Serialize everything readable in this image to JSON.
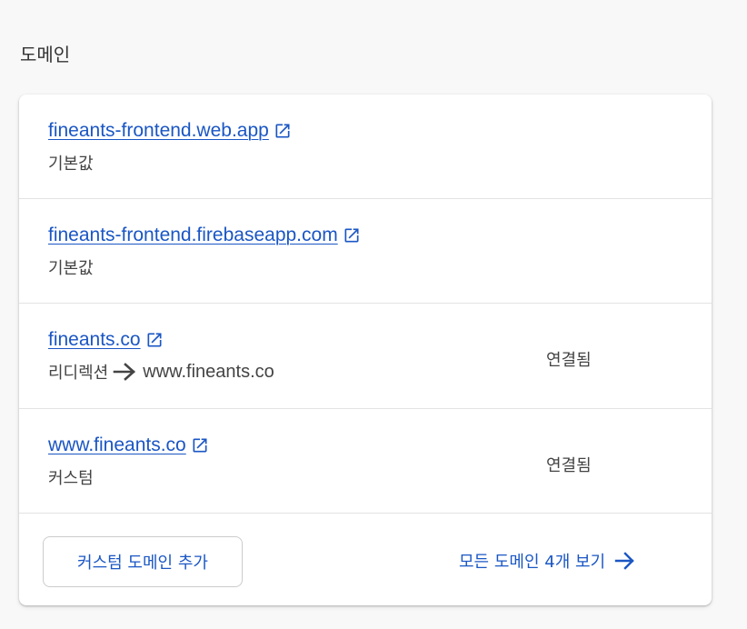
{
  "section": {
    "title": "도메인"
  },
  "domains": [
    {
      "url": "fineants-frontend.web.app",
      "type": "기본값",
      "status": ""
    },
    {
      "url": "fineants-frontend.firebaseapp.com",
      "type": "기본값",
      "status": ""
    },
    {
      "url": "fineants.co",
      "type": "리디렉션",
      "redirect_target": "www.fineants.co",
      "status": "연결됨"
    },
    {
      "url": "www.fineants.co",
      "type": "커스텀",
      "status": "연결됨"
    }
  ],
  "footer": {
    "add_button_label": "커스텀 도메인 추가",
    "view_all_label": "모든 도메인 4개 보기"
  },
  "icons": {
    "external_link": "open-in-new-icon",
    "redirect_arrow": "arrow-right-icon",
    "view_all_arrow": "arrow-right-icon"
  },
  "colors": {
    "link": "#1a56c4",
    "text_secondary": "#444444",
    "background": "#f8f8f8",
    "card": "#ffffff",
    "divider": "#e3e3e3"
  }
}
